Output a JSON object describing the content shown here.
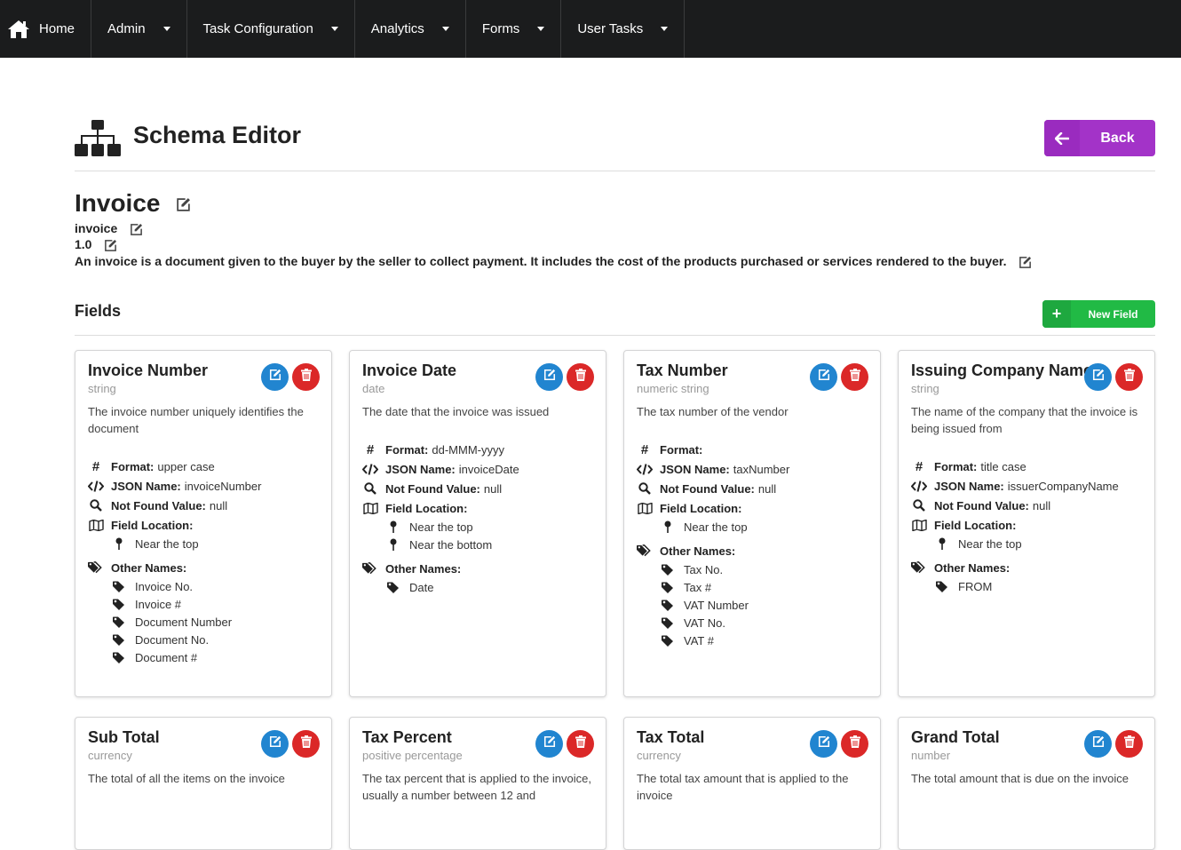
{
  "nav": {
    "items": [
      {
        "label": "Home",
        "icon": "home-icon",
        "dropdown": false
      },
      {
        "label": "Admin",
        "dropdown": true
      },
      {
        "label": "Task Configuration",
        "dropdown": true
      },
      {
        "label": "Analytics",
        "dropdown": true
      },
      {
        "label": "Forms",
        "dropdown": true
      },
      {
        "label": "User Tasks",
        "dropdown": true
      }
    ]
  },
  "header": {
    "title": "Schema Editor",
    "icon": "sitemap-icon",
    "back_label": "Back"
  },
  "schema": {
    "title": "Invoice",
    "name": "invoice",
    "version": "1.0",
    "description": "An invoice is a document given to the buyer by the seller to collect payment. It includes the cost of the products purchased or services rendered to the buyer."
  },
  "fields_section": {
    "title": "Fields",
    "new_field_label": "New Field"
  },
  "labels": {
    "format": "Format:",
    "json_name": "JSON Name:",
    "not_found": "Not Found Value:",
    "field_location": "Field Location:",
    "other_names": "Other Names:"
  },
  "fields": [
    {
      "title": "Invoice Number",
      "type": "string",
      "description": "The invoice number uniquely identifies the document",
      "format": "upper case",
      "json_name": "invoiceNumber",
      "not_found": "null",
      "locations": [
        "Near the top"
      ],
      "other_names": [
        "Invoice No.",
        "Invoice #",
        "Document Number",
        "Document No.",
        "Document #"
      ]
    },
    {
      "title": "Invoice Date",
      "type": "date",
      "description": "The date that the invoice was issued",
      "format": "dd-MMM-yyyy",
      "json_name": "invoiceDate",
      "not_found": "null",
      "locations": [
        "Near the top",
        "Near the bottom"
      ],
      "other_names": [
        "Date"
      ]
    },
    {
      "title": "Tax Number",
      "type": "numeric string",
      "description": "The tax number of the vendor",
      "format": "",
      "json_name": "taxNumber",
      "not_found": "null",
      "locations": [
        "Near the top"
      ],
      "other_names": [
        "Tax No.",
        "Tax #",
        "VAT Number",
        "VAT No.",
        "VAT #"
      ]
    },
    {
      "title": "Issuing Company Name",
      "type": "string",
      "description": "The name of the company that the invoice is being issued from",
      "format": "title case",
      "json_name": "issuerCompanyName",
      "not_found": "null",
      "locations": [
        "Near the top"
      ],
      "other_names": [
        "FROM"
      ]
    },
    {
      "title": "Sub Total",
      "type": "currency",
      "description": "The total of all the items on the invoice"
    },
    {
      "title": "Tax Percent",
      "type": "positive percentage",
      "description": "The tax percent that is applied to the invoice, usually a number between 12 and"
    },
    {
      "title": "Tax Total",
      "type": "currency",
      "description": "The total tax amount that is applied to the invoice"
    },
    {
      "title": "Grand Total",
      "type": "number",
      "description": "The total amount that is due on the invoice"
    }
  ],
  "colors": {
    "nav": "#1b1c1d",
    "back": "#a333c8",
    "new_field": "#21ba45",
    "edit": "#2185d0",
    "delete": "#db2828"
  }
}
